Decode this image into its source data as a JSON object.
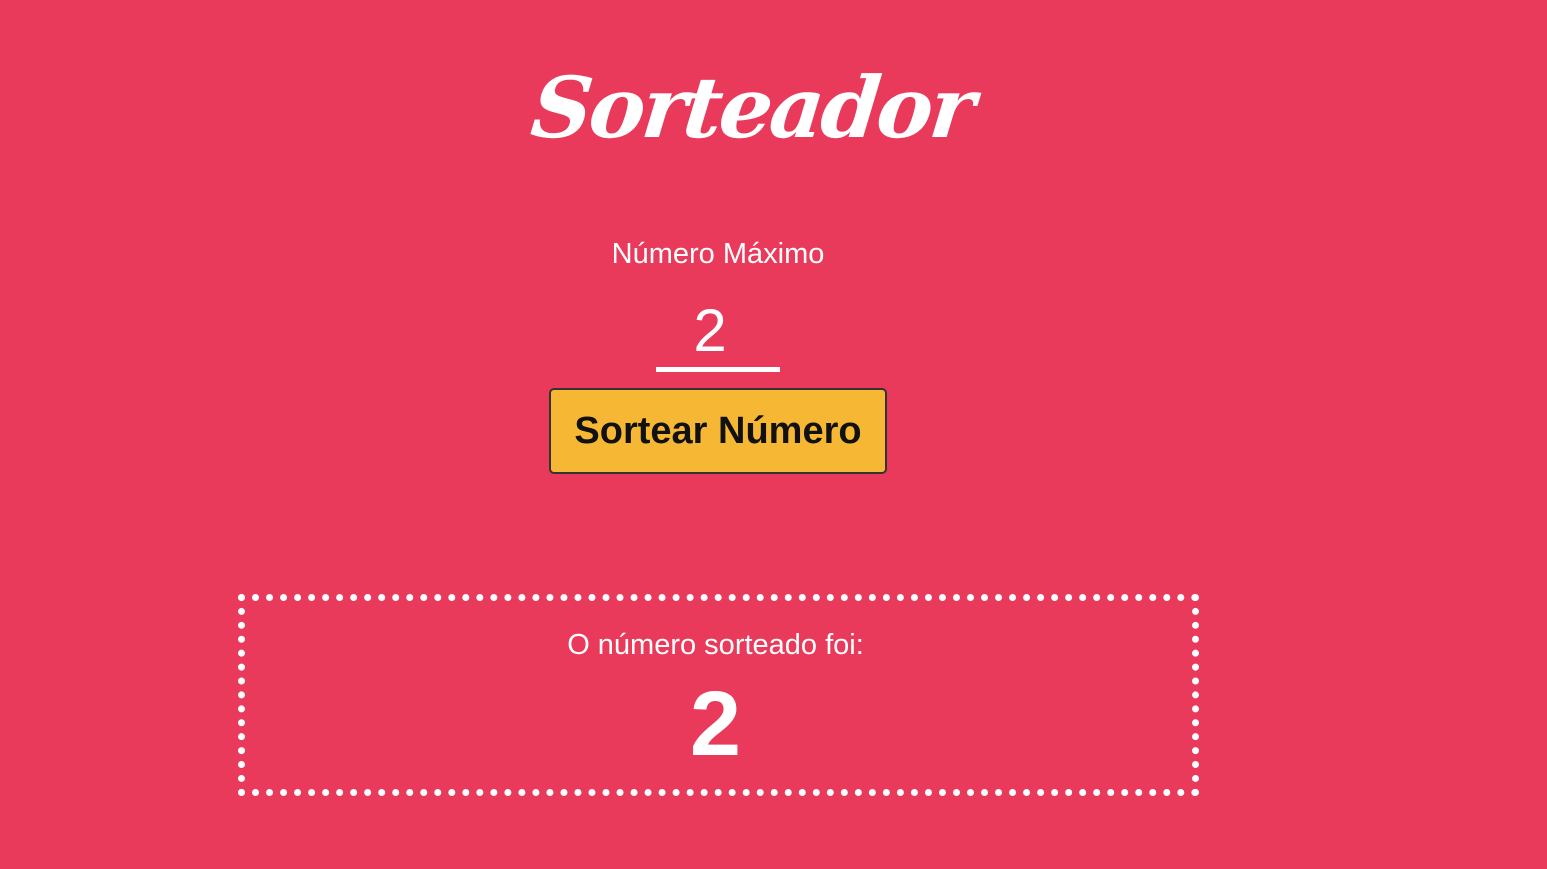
{
  "app": {
    "title": "Sorteador"
  },
  "form": {
    "max_label": "Número Máximo",
    "max_value": "2",
    "draw_button_label": "Sortear Número"
  },
  "result": {
    "label": "O número sorteado foi:",
    "value": "2"
  },
  "colors": {
    "background": "#EA3A5C",
    "button": "#F6B834",
    "text": "#FFFFFF"
  }
}
